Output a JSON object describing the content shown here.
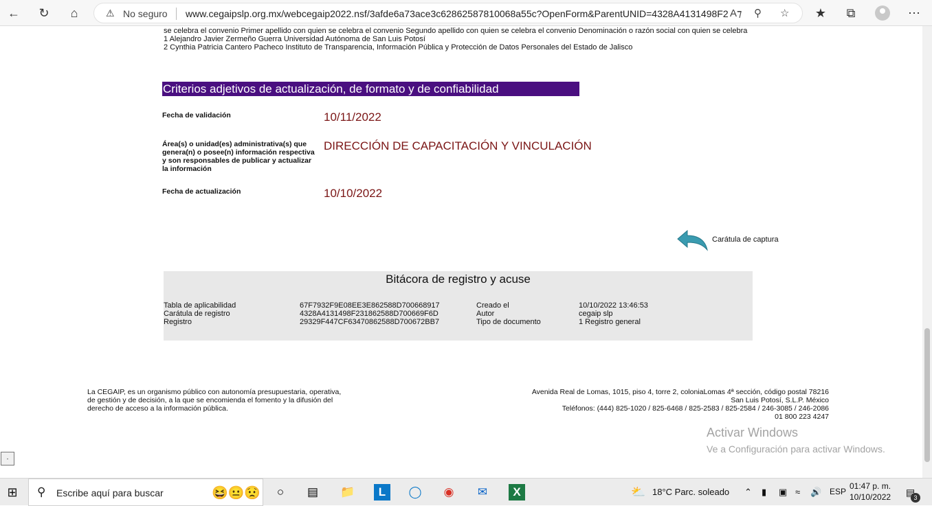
{
  "browser": {
    "security_text": "No seguro",
    "url": "www.cegaipslp.org.mx/webcegaip2022.nsf/3afde6a73ace3c62862587810068a55c?OpenForm&ParentUNID=4328A4131498F2..."
  },
  "page": {
    "top_lines": [
      "se celebra el convenio Primer apellido con quien se celebra el convenio Segundo apellido con quien se celebra el convenio Denominación o razón social con quien se celebra",
      "1 Alejandro Javier Zermeño Guerra Universidad Autónoma de San Luis Potosí",
      "2 Cynthia Patricia Cantero Pacheco Instituto de Transparencia, Información Pública y Protección de Datos Personales del Estado de Jalisco"
    ],
    "section_title": "Criterios adjetivos de actualización, de formato y de confiabilidad",
    "fields": [
      {
        "label": "Fecha de validación",
        "value": "10/11/2022"
      },
      {
        "label": "Área(s) o unidad(es) administrativa(s) que genera(n) o posee(n) información respectiva y son responsables de publicar y actualizar la información",
        "value": "DIRECCIÓN DE CAPACITACIÓN Y VINCULACIÓN"
      },
      {
        "label": "Fecha de actualización",
        "value": "10/10/2022"
      }
    ],
    "back_link": "Carátula de captura",
    "bitacora": {
      "title": "Bitácora de registro y acuse",
      "rows": [
        {
          "k1": "Tabla de aplicabilidad",
          "v1": "67F7932F9E08EE3E862588D700668917",
          "k2": "Creado el",
          "v2": "10/10/2022 13:46:53"
        },
        {
          "k1": "Carátula de registro",
          "v1": "4328A4131498F231862588D700669F6D",
          "k2": "Autor",
          "v2": "cegaip slp"
        },
        {
          "k1": "Registro",
          "v1": "29329F447CF63470862588D700672BB7",
          "k2": "Tipo de documento",
          "v2": "1 Registro general"
        }
      ]
    },
    "footer_left": [
      "La CEGAIP, es un organismo público con autonomía presupuestaria, operativa,",
      "de gestión y de decisión, a la que se encomienda el fomento y la difusión del",
      "derecho de acceso a la información pública."
    ],
    "footer_right": [
      "Avenida Real de Lomas, 1015, piso 4, torre 2, coloniaLomas 4ª sección, código postal 78216",
      "San Luis Potosí, S.L.P. México",
      "Teléfonos: (444) 825-1020 / 825-6468 / 825-2583 / 825-2584 / 246-3085 / 246-2086",
      "01 800 223 4247"
    ],
    "activate_title": "Activar Windows",
    "activate_sub": "Ve a Configuración para activar Windows.",
    "dot_button": "."
  },
  "taskbar": {
    "search_placeholder": "Escribe aquí para buscar",
    "weather": "18°C  Parc. soleado",
    "lang": "ESP",
    "time": "01:47 p. m.",
    "date": "10/10/2022",
    "notifications": "3"
  }
}
